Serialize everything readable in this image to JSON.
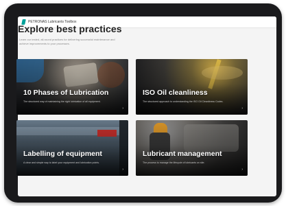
{
  "app": {
    "title": "PETRONAS Lubricants Toolbox",
    "logo_color": "#00a19a"
  },
  "page": {
    "heading": "Explore best practices",
    "subtitle_line1": "Learn our tested, all-round practices for delivering successful maintenance and",
    "subtitle_line2": "achieve improvements to your processes."
  },
  "cards": [
    {
      "title": "10 Phases of Lubrication",
      "description": "The structured way of maintaining the right lubrication of all equipment.",
      "arrow_icon": "chevron-right-icon"
    },
    {
      "title": "ISO Oil cleanliness",
      "description": "The structured approach to understanding the ISO Oil Cleanliness Codes.",
      "arrow_icon": "chevron-right-icon"
    },
    {
      "title": "Labelling of equipment",
      "description": "A clear and simple way to label your equipment and lubrication points.",
      "arrow_icon": "chevron-right-icon"
    },
    {
      "title": "Lubricant management",
      "description": "The process to manage the lifecycle of lubricants on site.",
      "arrow_icon": "chevron-right-icon"
    }
  ]
}
